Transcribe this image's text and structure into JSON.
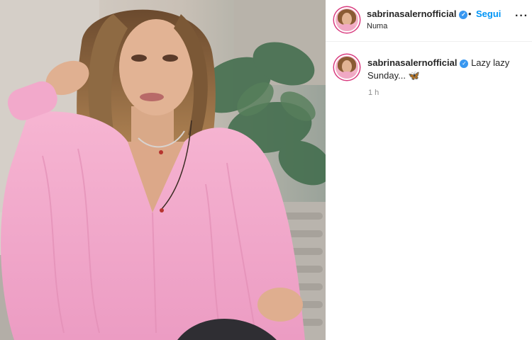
{
  "post": {
    "username": "sabrinasalernofficial",
    "verified_icon": "verified-badge-icon",
    "separator": "•",
    "follow_label": "Segui",
    "location": "Numa",
    "more_icon": "more-options-icon",
    "more_label": "···"
  },
  "caption": {
    "username": "sabrinasalernofficial",
    "text": "Lazy lazy Sunday...",
    "emoji": "🦋",
    "time": "1 h"
  },
  "colors": {
    "accent": "#0095f6",
    "verified": "#3897f0",
    "blouse": "#f2a9cb",
    "story_ring": "#d93b7f"
  }
}
